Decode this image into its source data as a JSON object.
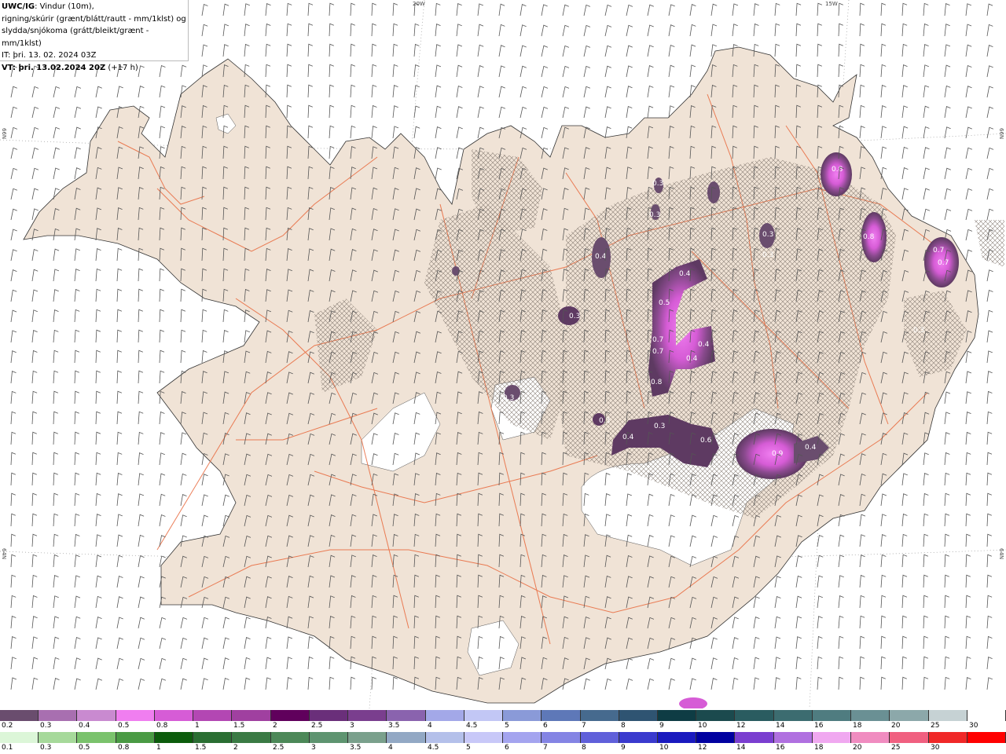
{
  "header": {
    "product": "UWC/IG",
    "line1_rest": ": Vindur (10m),",
    "line2": "rigning/skúrir (grænt/blátt/rautt - mm/1klst) og",
    "line3": "slydda/snjókoma (grátt/bleikt/grænt - mm/1klst)",
    "it_line": "IT: þri. 13. 02. 2024 03Z",
    "vt_bold": "VT: þri. 13.02.2024 20Z",
    "vt_rest": " (+17 h)"
  },
  "coords": {
    "lon_top_1": "20W",
    "lon_top_2": "15W",
    "lat_left_1": "66N",
    "lat_left_2": "64N",
    "lat_right_1": "66N",
    "lat_right_2": "64N"
  },
  "colors": {
    "land": "#f0e3d6",
    "roads": "#e8683c",
    "glacier": "#ffffff",
    "sea": "#ffffff"
  },
  "precip_labels": [
    "0.8",
    "0.8",
    "0.7",
    "0.7",
    "0.3",
    "0.4",
    "0.4",
    "0.5",
    "0.7",
    "0.7",
    "0.8",
    "0.4",
    "0.4",
    "0.3",
    "0.3",
    "0.3",
    "0.4",
    "0.3",
    "0.6",
    "0.9",
    "0.4",
    "0.3",
    "0.3",
    "0.3",
    "0.3"
  ],
  "scale_top": {
    "labels": [
      "0.2",
      "0.3",
      "0.4",
      "0.5",
      "0.8",
      "1",
      "1.5",
      "2",
      "2.5",
      "3",
      "3.5",
      "4",
      "4.5",
      "5",
      "6",
      "7",
      "8",
      "9",
      "10",
      "12",
      "14",
      "16",
      "18",
      "20",
      "25",
      "30"
    ],
    "colors": [
      "#6a4d6e",
      "#a86fb0",
      "#c98ad0",
      "#f07ef0",
      "#d65cd6",
      "#b347b3",
      "#a040a0",
      "#60005c",
      "#6a2f7a",
      "#7a3e8e",
      "#8a63ae",
      "#a3a8e8",
      "#c2c7f5",
      "#8a9ad8",
      "#5e78b8",
      "#466a8e",
      "#2f5472",
      "#0e3c44",
      "#1b4a4e",
      "#2a5c60",
      "#3c6c70",
      "#4f7c80",
      "#6a9094",
      "#8ca8aa",
      "#c6d2d4",
      "#ffffff"
    ]
  },
  "scale_bottom": {
    "labels": [
      "0.1",
      "0.3",
      "0.5",
      "0.8",
      "1",
      "1.5",
      "2",
      "2.5",
      "3",
      "3.5",
      "4",
      "4.5",
      "5",
      "6",
      "7",
      "8",
      "9",
      "10",
      "12",
      "14",
      "16",
      "18",
      "20",
      "25",
      "30"
    ],
    "colors": [
      "#dcf6d8",
      "#a6d99a",
      "#7ac26c",
      "#4a9a44",
      "#0c5c0c",
      "#2a6e32",
      "#3a7a44",
      "#4c8858",
      "#5e9470",
      "#7aa08c",
      "#92a8c4",
      "#b4c0ea",
      "#c8c8f8",
      "#a4a4ef",
      "#8484e4",
      "#6060da",
      "#3a3ace",
      "#1a1abf",
      "#0000a0",
      "#7a3ed0",
      "#b070e0",
      "#f0a8f0",
      "#f08cc0",
      "#f06080",
      "#f02828",
      "#ff0000"
    ]
  }
}
